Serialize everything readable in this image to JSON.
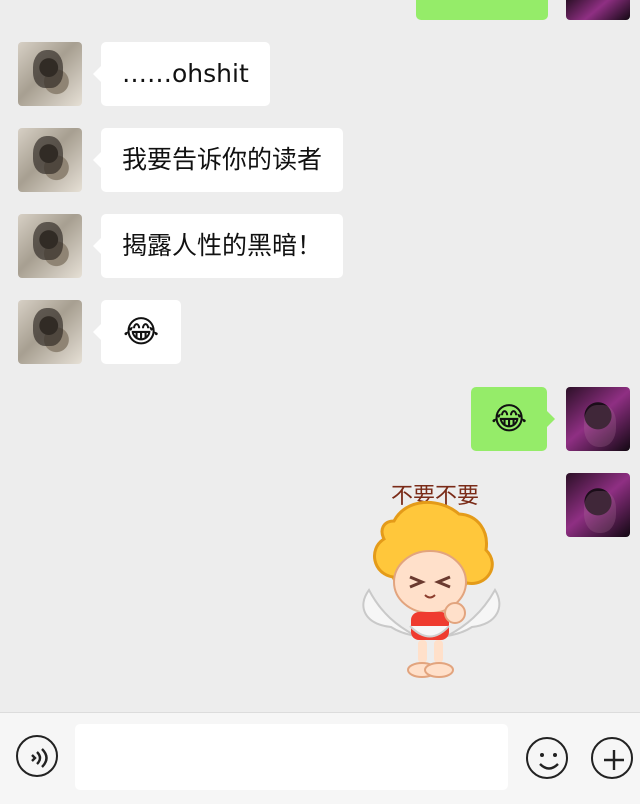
{
  "chat": {
    "messages": [
      {
        "side": "left",
        "text": "……ohshit"
      },
      {
        "side": "left",
        "text": "我要告诉你的读者"
      },
      {
        "side": "left",
        "text": "揭露人性的黑暗！"
      },
      {
        "side": "left",
        "emoji": "😂"
      },
      {
        "side": "right",
        "emoji": "😂"
      }
    ],
    "sticker_text": "不要不要"
  },
  "icons": {
    "voice": "voice-icon",
    "emoji": "emoji-icon",
    "plus": "plus-icon"
  }
}
